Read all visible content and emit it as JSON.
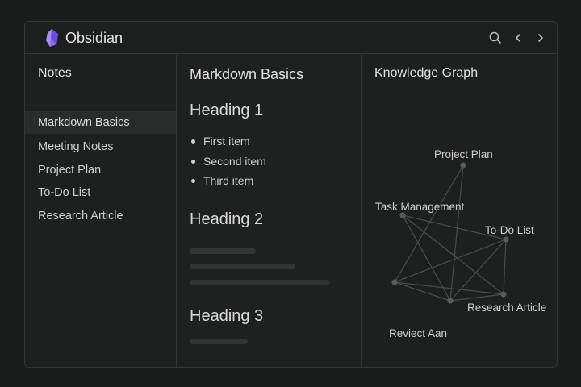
{
  "app": {
    "title": "Obsidian",
    "accent_color": "#8b6cf0",
    "toolbar_icons": [
      "search-icon",
      "chevron-left-icon",
      "chevron-right-icon"
    ]
  },
  "sidebar": {
    "title": "Notes",
    "items": [
      {
        "label": "Markdown Basics",
        "active": true
      },
      {
        "label": "Meeting Notes"
      },
      {
        "label": "Project Plan"
      },
      {
        "label": "To-Do List"
      },
      {
        "label": "Research Article"
      }
    ]
  },
  "editor": {
    "title": "Markdown Basics",
    "heading1": "Heading 1",
    "bullets": [
      "First item",
      "Second item",
      "Third item"
    ],
    "heading2": "Heading 2",
    "heading3": "Heading 3"
  },
  "graph": {
    "title": "Knowledge Graph",
    "nodes": [
      {
        "id": "project",
        "label": "Project Plan"
      },
      {
        "id": "task",
        "label": "Task Management"
      },
      {
        "id": "todo",
        "label": "To-Do List"
      },
      {
        "id": "left",
        "label": ""
      },
      {
        "id": "center",
        "label": ""
      },
      {
        "id": "research",
        "label": "Research Article"
      },
      {
        "id": "reviect",
        "label": "Reviect Aan"
      }
    ],
    "edges": [
      [
        "project",
        "center"
      ],
      [
        "project",
        "left"
      ],
      [
        "task",
        "center"
      ],
      [
        "task",
        "research"
      ],
      [
        "task",
        "todo"
      ],
      [
        "left",
        "todo"
      ],
      [
        "left",
        "center"
      ],
      [
        "left",
        "research"
      ],
      [
        "todo",
        "center"
      ],
      [
        "todo",
        "research"
      ],
      [
        "center",
        "research"
      ],
      [
        "center",
        "reviect"
      ]
    ]
  }
}
